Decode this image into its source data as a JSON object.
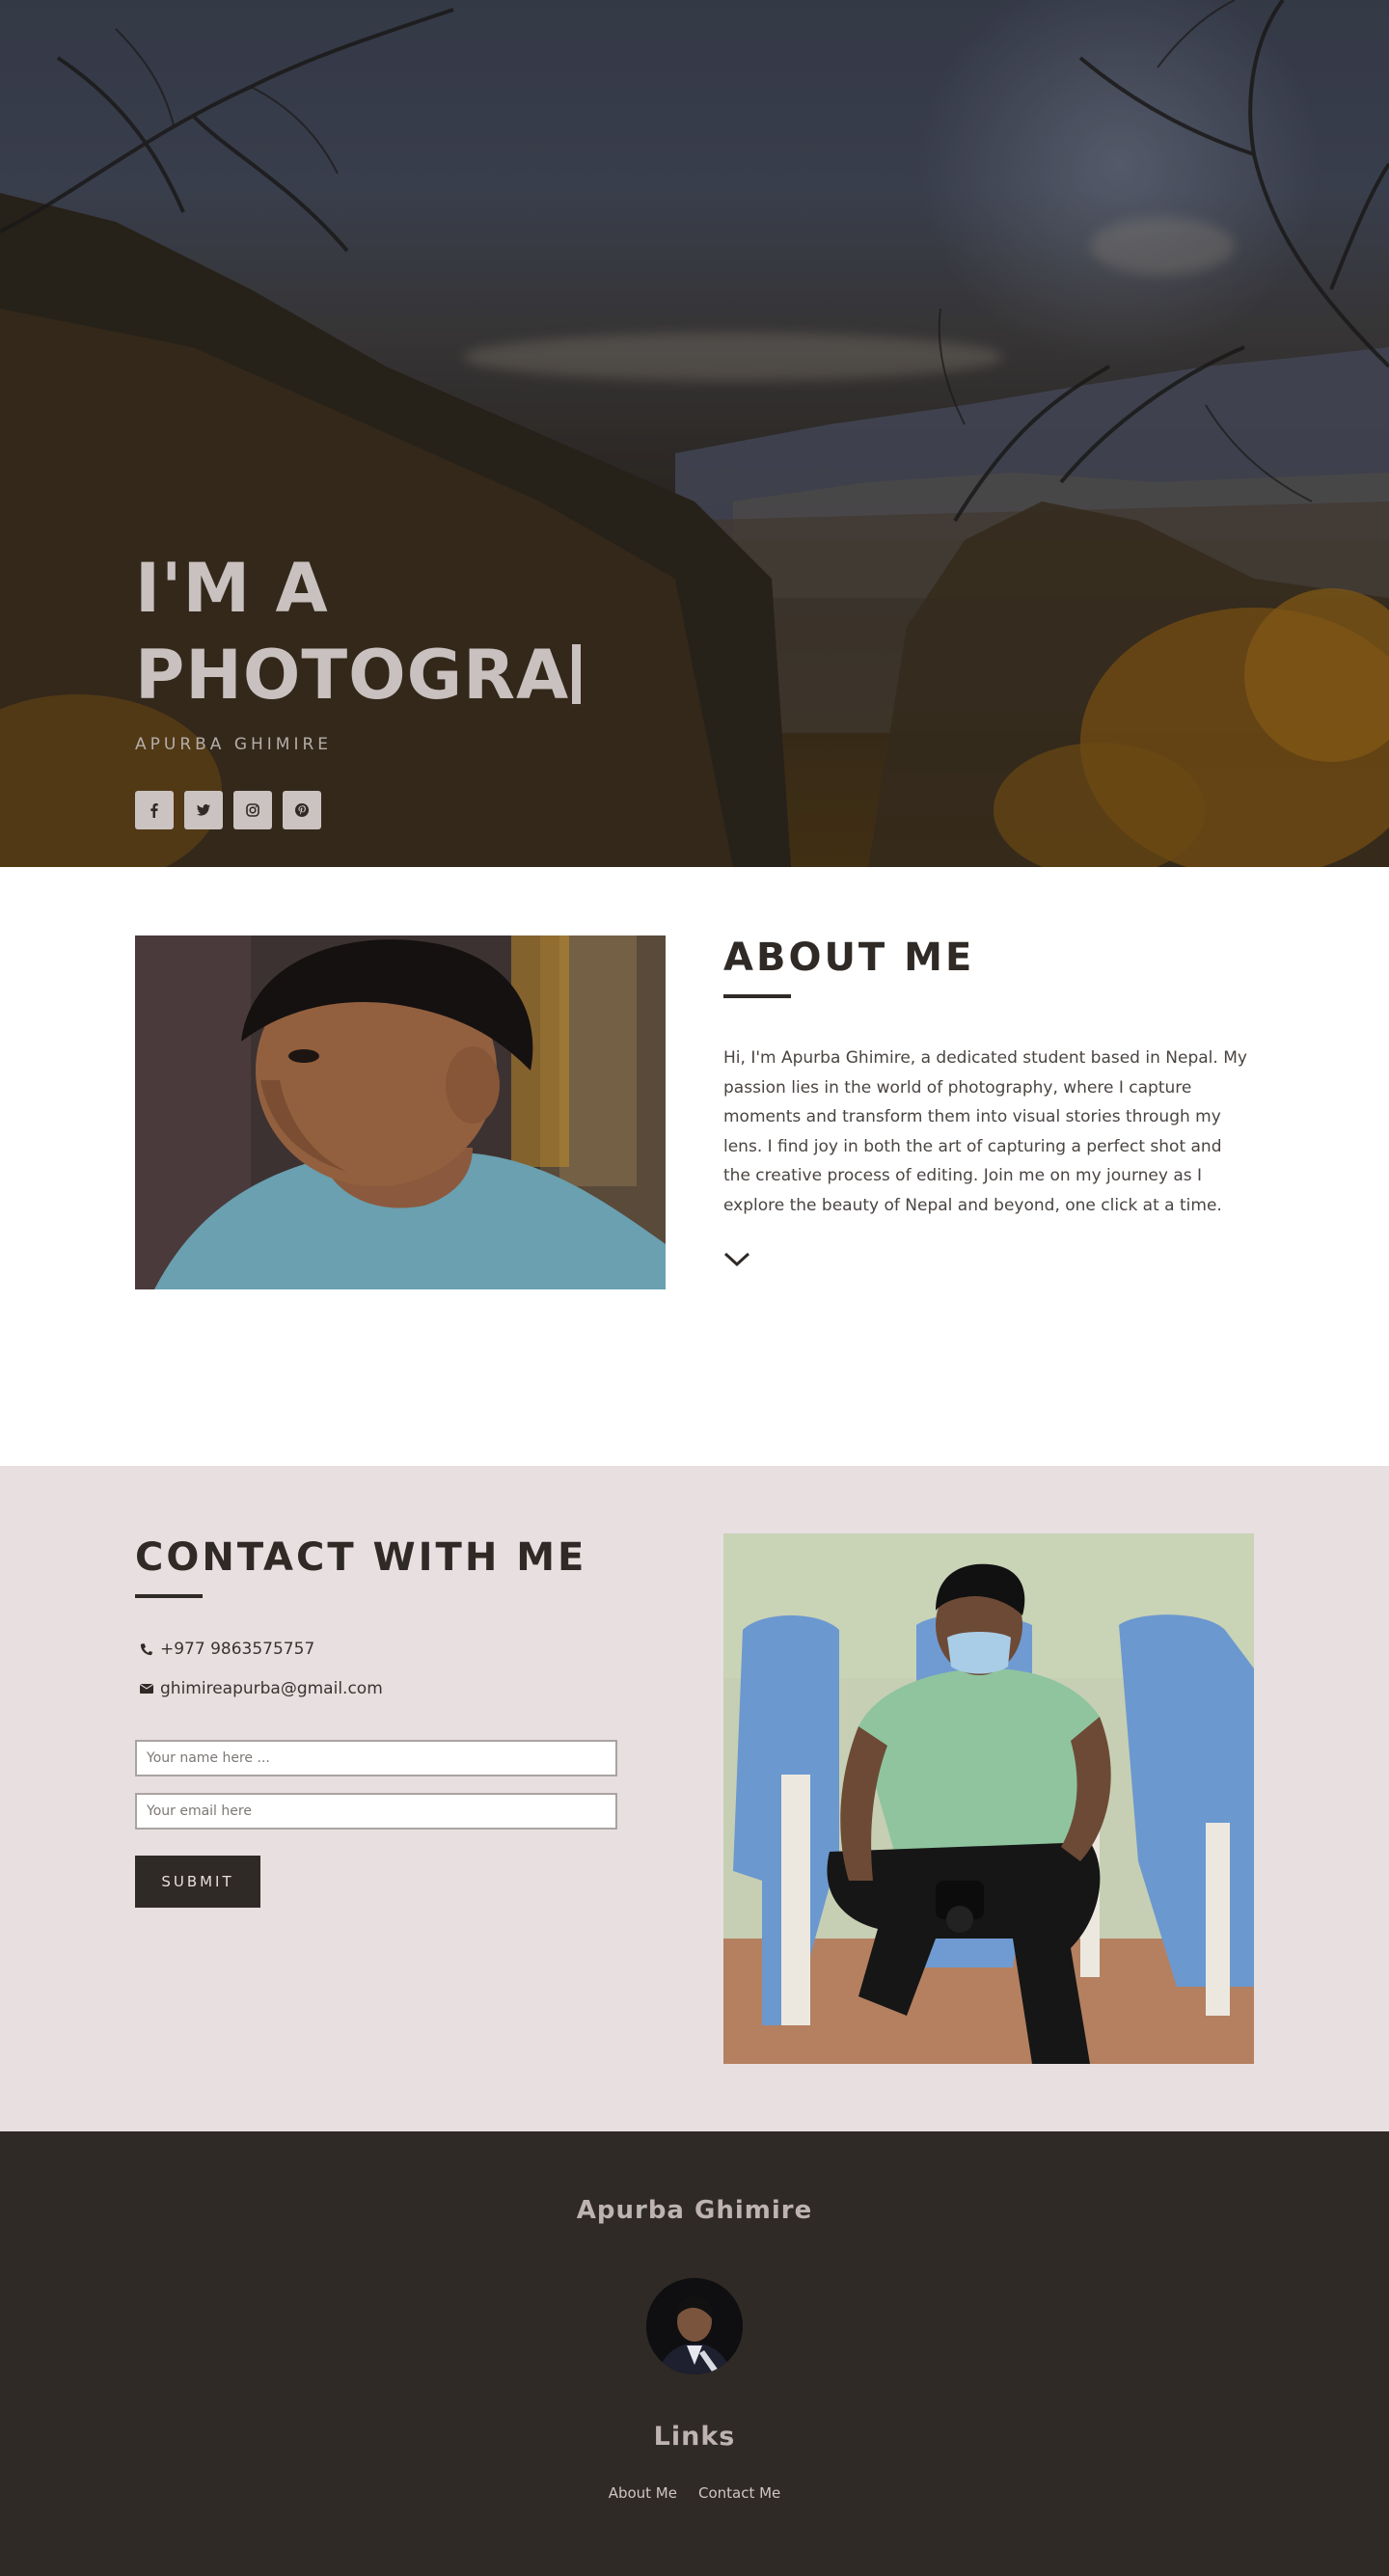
{
  "hero": {
    "title_line1": "I'M A",
    "title_line2": "PHOTOGRA",
    "subtitle": "APURBA GHIMIRE",
    "social": [
      {
        "name": "facebook-icon"
      },
      {
        "name": "twitter-icon"
      },
      {
        "name": "instagram-icon"
      },
      {
        "name": "pinterest-icon"
      }
    ]
  },
  "about": {
    "title": "ABOUT ME",
    "text": "Hi, I'm Apurba Ghimire, a dedicated student based in Nepal. My passion lies in the world of photography, where I capture moments and transform them into visual stories through my lens. I find joy in both the art of capturing a perfect shot and the creative process of editing. Join me on my journey as I explore the beauty of Nepal and beyond, one click at a time."
  },
  "contact": {
    "title": "CONTACT WITH ME",
    "phone": "+977 9863575757",
    "email": "ghimireapurba@gmail.com",
    "name_placeholder": "Your name here ...",
    "email_placeholder": "Your email here",
    "submit_label": "SUBMIT"
  },
  "footer": {
    "name": "Apurba Ghimire",
    "links_title": "Links",
    "links": [
      "About Me",
      "Contact Me"
    ]
  },
  "colors": {
    "dark": "#2f2a26",
    "contact_bg": "#e8dfe0",
    "hero_text": "#c9c1bf"
  }
}
